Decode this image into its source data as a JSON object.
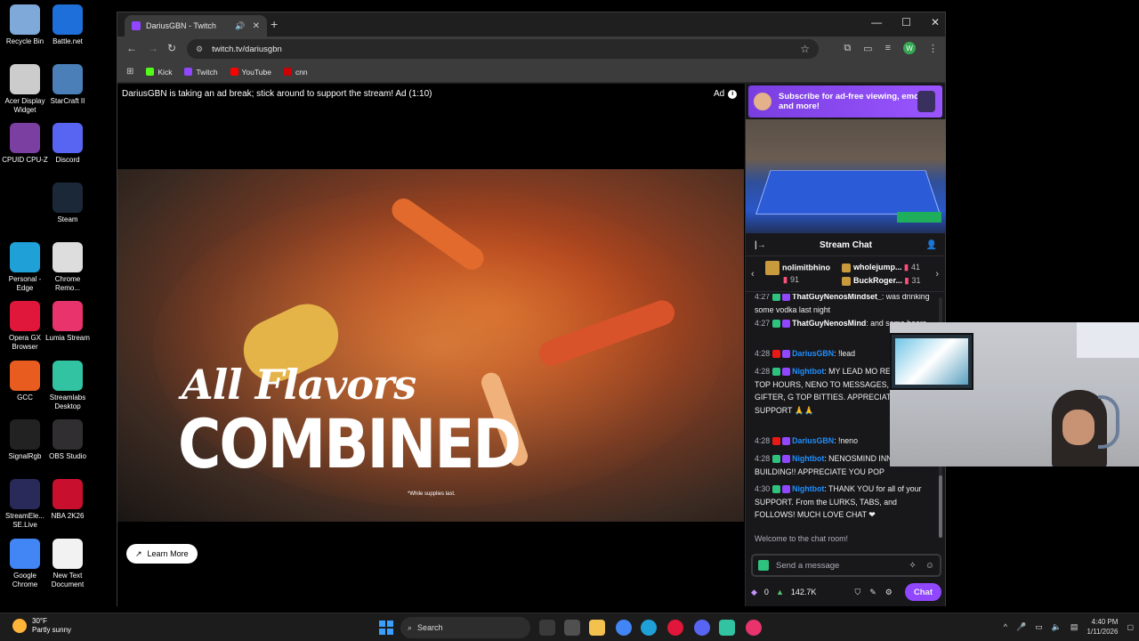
{
  "desktop": {
    "icons": [
      {
        "label": "Recycle Bin",
        "color": "#7fa9d9"
      },
      {
        "label": "Battle.net",
        "color": "#1e6fd9"
      },
      {
        "label": "Acer Display Widget",
        "color": "#cccccc"
      },
      {
        "label": "StarCraft II",
        "color": "#4a7fb8"
      },
      {
        "label": "CPUID CPU-Z",
        "color": "#7a3fa0"
      },
      {
        "label": "Discord",
        "color": "#5865f2"
      },
      {
        "label": "Steam",
        "color": "#1b2838"
      },
      {
        "label": "Personal - Edge",
        "color": "#1fa1d8"
      },
      {
        "label": "Chrome Remo...",
        "color": "#dddddd"
      },
      {
        "label": "Opera GX Browser",
        "color": "#e0163a"
      },
      {
        "label": "Lumia Stream",
        "color": "#e8336d"
      },
      {
        "label": "GCC",
        "color": "#e85d1f"
      },
      {
        "label": "Streamlabs Desktop",
        "color": "#31c3a2"
      },
      {
        "label": "SignalRgb",
        "color": "#222222"
      },
      {
        "label": "OBS Studio",
        "color": "#302e31"
      },
      {
        "label": "StreamEle... SE.Live",
        "color": "#2a2a5a"
      },
      {
        "label": "NBA 2K26",
        "color": "#c8102e"
      },
      {
        "label": "Google Chrome",
        "color": "#4285f4"
      },
      {
        "label": "New Text Document",
        "color": "#f2f2f2"
      }
    ]
  },
  "browser": {
    "tab_title": "DariusGBN - Twitch",
    "url": "twitch.tv/dariusgbn",
    "profile_initial": "W",
    "bookmarks": [
      {
        "label": "Kick",
        "color": "#53fc18"
      },
      {
        "label": "Twitch",
        "color": "#9146ff"
      },
      {
        "label": "YouTube",
        "color": "#ff0000"
      },
      {
        "label": "cnn",
        "color": "#cc0000"
      }
    ]
  },
  "ad": {
    "notice": "DariusGBN is taking an ad break; stick around to support the stream! Ad (1:10)",
    "label": "Ad",
    "headline1": "All Flavors",
    "headline2": "COMBINED",
    "fineprint": "*While supplies last.",
    "learn_more": "Learn More"
  },
  "side": {
    "subscribe_banner": "Subscribe for ad-free viewing, emotes, and more!",
    "chat_title": "Stream Chat",
    "leaderboard": [
      {
        "name": "nolimitbhino",
        "count": "91"
      },
      {
        "name": "wholejump...",
        "count": "41"
      },
      {
        "name": "BuckRoger...",
        "count": "31"
      }
    ],
    "messages": [
      {
        "time": "4:27",
        "user": "ThatGuyNenosMindset_",
        "user_color": "#ffffff",
        "text": "was drinking some vodka last night"
      },
      {
        "time": "4:27",
        "user": "ThatGuyNenosMind",
        "user_color": "#ffffff",
        "text": "and some beers"
      },
      {
        "time": "4:28",
        "user": "DariusGBN",
        "user_color": "#1e90ff",
        "text": "!lead"
      },
      {
        "time": "4:28",
        "user": "Nightbot",
        "user_color": "#1e90ff",
        "text": "MY LEAD MO REBOUNDS TOP HOURS, NENO TO MESSAGES, BHINO TOP GIFTER, G TOP BITTIES. APPRECIATE ALL YA SUPPORT 🙏🙏"
      },
      {
        "time": "4:28",
        "user": "DariusGBN",
        "user_color": "#1e90ff",
        "text": "!neno"
      },
      {
        "time": "4:28",
        "user": "Nightbot",
        "user_color": "#1e90ff",
        "text": "NENOSMIND INNA BUILDING!! APPRECIATE YOU POP"
      },
      {
        "time": "4:30",
        "user": "Nightbot",
        "user_color": "#1e90ff",
        "text": "THANK YOU for all of your SUPPORT. From the LURKS, TABS, and FOLLOWS! MUCH LOVE CHAT ❤"
      }
    ],
    "welcome": "Welcome to the chat room!",
    "input_placeholder": "Send a message",
    "points": "0",
    "channel_points": "142.7K",
    "chat_button": "Chat"
  },
  "taskbar": {
    "temperature": "30°F",
    "condition": "Partly sunny",
    "search_label": "Search",
    "time": "4:40 PM",
    "date": "1/11/2026"
  }
}
